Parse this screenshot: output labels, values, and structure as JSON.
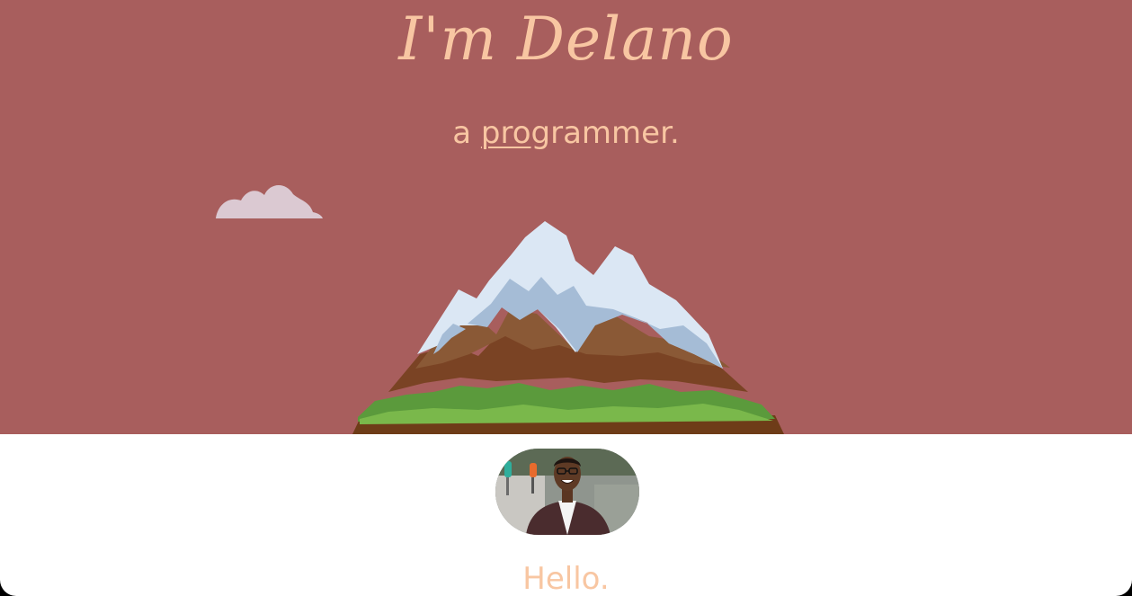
{
  "hero": {
    "title": "I'm Delano",
    "subtitle_prefix": "a ",
    "subtitle_typed": "pro",
    "subtitle_rest": "grammer.",
    "background_color": "#a85e5d",
    "text_color": "#f8c6a2",
    "icons": [
      "cloud-icon",
      "mountain-icon"
    ]
  },
  "profile": {
    "avatar_icon": "profile-photo"
  },
  "about": {
    "greeting": "Hello."
  }
}
